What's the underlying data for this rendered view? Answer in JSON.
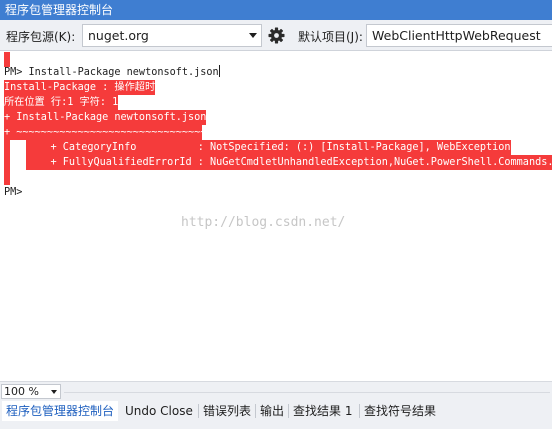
{
  "window": {
    "title": "程序包管理器控制台"
  },
  "toolbar": {
    "source_label": "程序包源(K):",
    "source_value": "nuget.org",
    "settings_icon": "gear-icon",
    "project_label": "默认项目(J):",
    "project_value": "WebClientHttpWebRequest"
  },
  "console": {
    "prompt_line": "PM> Install-Package newtonsoft.json",
    "error_lines": [
      "Install-Package : 操作超时",
      "所在位置 行:1 字符: 1",
      "+ Install-Package newtonsoft.json",
      "+ ~~~~~~~~~~~~~~~~~~~~~~~~~~~~~~~~",
      "    + CategoryInfo          : NotSpecified: (:) [Install-Package], WebException",
      "    + FullyQualifiedErrorId : NuGetCmdletUnhandledException,NuGet.PowerShell.Commands.InstallPackageCommand"
    ],
    "final_prompt": "PM>",
    "watermark": "http://blog.csdn.net/"
  },
  "zoom": {
    "value": "100 %"
  },
  "tabs": [
    {
      "label": "程序包管理器控制台",
      "active": true
    },
    {
      "label": "Undo Close",
      "active": false
    },
    {
      "label": "错误列表",
      "active": false
    },
    {
      "label": "输出",
      "active": false
    },
    {
      "label": "查找结果 1",
      "active": false
    },
    {
      "label": "查找符号结果",
      "active": false
    }
  ],
  "colors": {
    "title_bar": "#3f7ed1",
    "error_background": "#f53b3b",
    "error_text": "#ffffff",
    "active_tab_text": "#1e5fbf"
  }
}
